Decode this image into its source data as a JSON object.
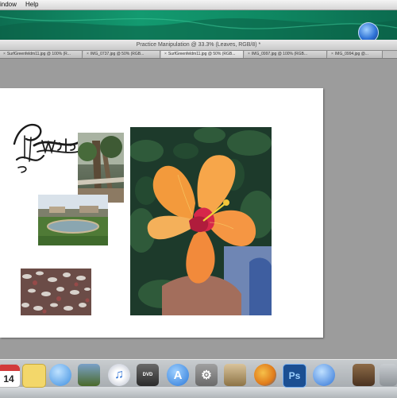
{
  "menubar": {
    "items": [
      "indow",
      "Help"
    ]
  },
  "window": {
    "title": "Practice Manipulation @ 33.3% (Leaves, RGB/8) *"
  },
  "tabs": [
    {
      "label": "SurfGreenfeldm11.jpg @ 100% (R..."
    },
    {
      "label": "IMG_0737.jpg @ 50% (RGB..."
    },
    {
      "label": "SurfGreenfeldm11.jpg @ 50% (RGB..."
    },
    {
      "label": "IMG_0997.jpg @ 100% (RGB..."
    },
    {
      "label": "IMG_0994.jpg @..."
    }
  ],
  "dock": {
    "calendar_date": "14",
    "photoshop_label": "Ps",
    "items": [
      {
        "name": "ical",
        "color": "#ffffff"
      },
      {
        "name": "stickies",
        "color": "#f3d76a"
      },
      {
        "name": "ichat",
        "color": "#5aa8ee"
      },
      {
        "name": "iphoto",
        "color": "#6b8f3d"
      },
      {
        "name": "itunes",
        "color": "#e8e8ee"
      },
      {
        "name": "dvd-player",
        "color": "#4b4b4b"
      },
      {
        "name": "app-store",
        "color": "#2a78d8"
      },
      {
        "name": "system-preferences",
        "color": "#8d8d8d"
      },
      {
        "name": "preview",
        "color": "#b59a6a"
      },
      {
        "name": "firefox",
        "color": "#e07b1a"
      },
      {
        "name": "photoshop",
        "color": "#1b4f92"
      },
      {
        "name": "spotlight",
        "color": "#2f73d6"
      },
      {
        "name": "downloads",
        "color": "#6b4a2e"
      },
      {
        "name": "finder",
        "color": "#9aa0a6"
      }
    ]
  }
}
